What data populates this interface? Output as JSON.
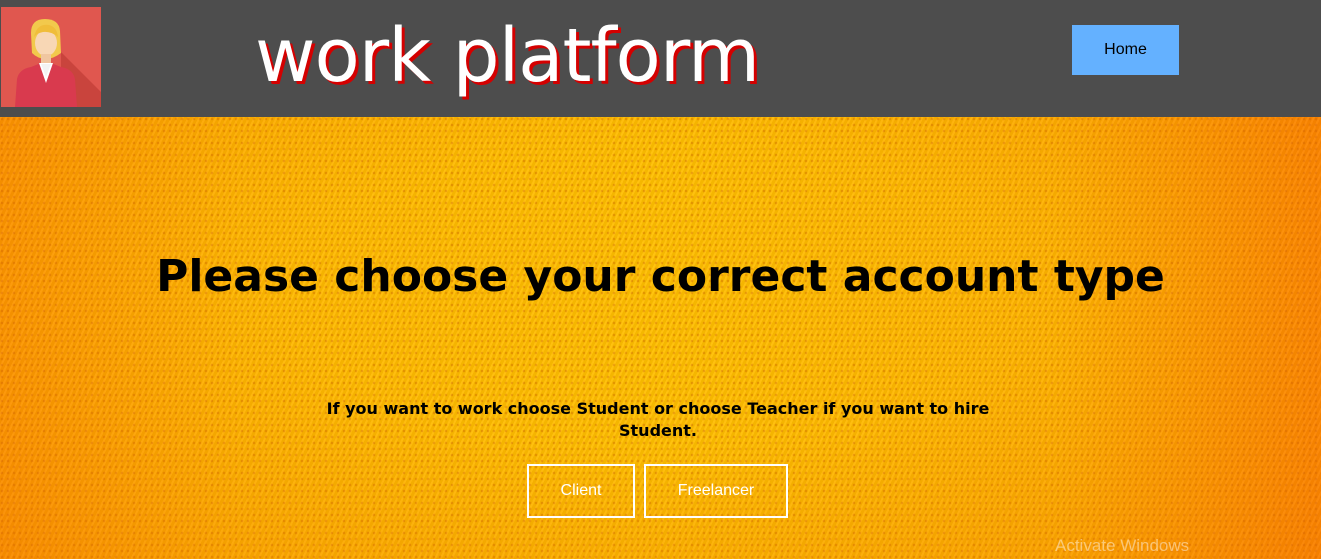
{
  "header": {
    "logo_icon": "businesswoman-avatar-icon",
    "site_title": "work platform",
    "home_label": "Home",
    "colors": {
      "background": "#4d4d4d",
      "title_shadow": "#d40000",
      "home_button": "#64b1ff"
    }
  },
  "hero": {
    "heading": "Please choose your correct account type",
    "subtext": "If you want to work choose Student or choose Teacher if you want to hire Student.",
    "buttons": {
      "client_label": "Client",
      "freelancer_label": "Freelancer"
    },
    "colors": {
      "background": "#ffb800"
    }
  },
  "watermark": "Activate Windows"
}
